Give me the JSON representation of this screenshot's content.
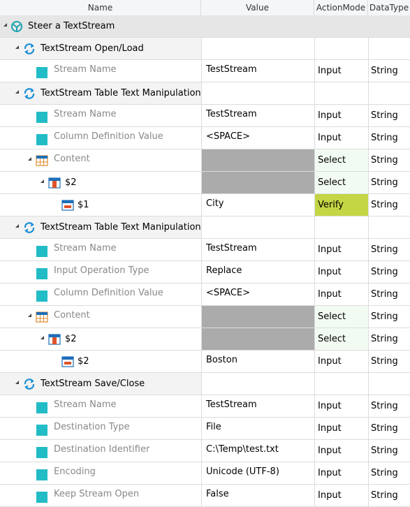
{
  "columns": [
    "Name",
    "Value",
    "ActionMode",
    "DataType"
  ],
  "root": {
    "label": "Steer a TextStream"
  },
  "rows": [
    {
      "kind": "step",
      "label": "TextStream Open/Load"
    },
    {
      "kind": "param",
      "label": "Stream Name",
      "value": "TestStream",
      "mode": "Input",
      "dtype": "String"
    },
    {
      "kind": "step",
      "label": "TextStream Table Text Manipulation"
    },
    {
      "kind": "param",
      "label": "Stream Name",
      "value": "TestStream",
      "mode": "Input",
      "dtype": "String"
    },
    {
      "kind": "param",
      "label": "Column Definition Value",
      "value": "<SPACE>",
      "mode": "Input",
      "dtype": "String"
    },
    {
      "kind": "table",
      "label": "Content",
      "mode": "Select",
      "dtype": "String"
    },
    {
      "kind": "column",
      "label": "$2",
      "mode": "Select",
      "dtype": "String"
    },
    {
      "kind": "cell",
      "label": "$1",
      "value": "City",
      "mode": "Verify",
      "dtype": "String"
    },
    {
      "kind": "step",
      "label": "TextStream Table Text Manipulation"
    },
    {
      "kind": "param",
      "label": "Stream Name",
      "value": "TestStream",
      "mode": "Input",
      "dtype": "String"
    },
    {
      "kind": "param",
      "label": "Input Operation Type",
      "value": "Replace",
      "mode": "Input",
      "dtype": "String"
    },
    {
      "kind": "param",
      "label": "Column Definition Value",
      "value": "<SPACE>",
      "mode": "Input",
      "dtype": "String"
    },
    {
      "kind": "table",
      "label": "Content",
      "mode": "Select",
      "dtype": "String"
    },
    {
      "kind": "column",
      "label": "$2",
      "mode": "Select",
      "dtype": "String"
    },
    {
      "kind": "cell",
      "label": "$2",
      "value": "Boston",
      "mode": "Input",
      "dtype": "String"
    },
    {
      "kind": "step",
      "label": "TextStream Save/Close"
    },
    {
      "kind": "param",
      "label": "Stream Name",
      "value": "TestStream",
      "mode": "Input",
      "dtype": "String"
    },
    {
      "kind": "param",
      "label": "Destination Type",
      "value": "File",
      "mode": "Input",
      "dtype": "String"
    },
    {
      "kind": "param",
      "label": "Destination Identifier",
      "value": "C:\\Temp\\test.txt",
      "mode": "Input",
      "dtype": "String"
    },
    {
      "kind": "param",
      "label": "Encoding",
      "value": "Unicode (UTF-8)",
      "mode": "Input",
      "dtype": "String"
    },
    {
      "kind": "param",
      "label": "Keep Stream Open",
      "value": "False",
      "mode": "Input",
      "dtype": "String"
    }
  ],
  "colors": {
    "param_square": "#22bcc6",
    "grey_value": "#ababab",
    "select_bg": "#f2fbf2",
    "verify_bg": "#c4d644",
    "root_band": "#e6e6e6",
    "step_band": "#f3f3f3"
  }
}
